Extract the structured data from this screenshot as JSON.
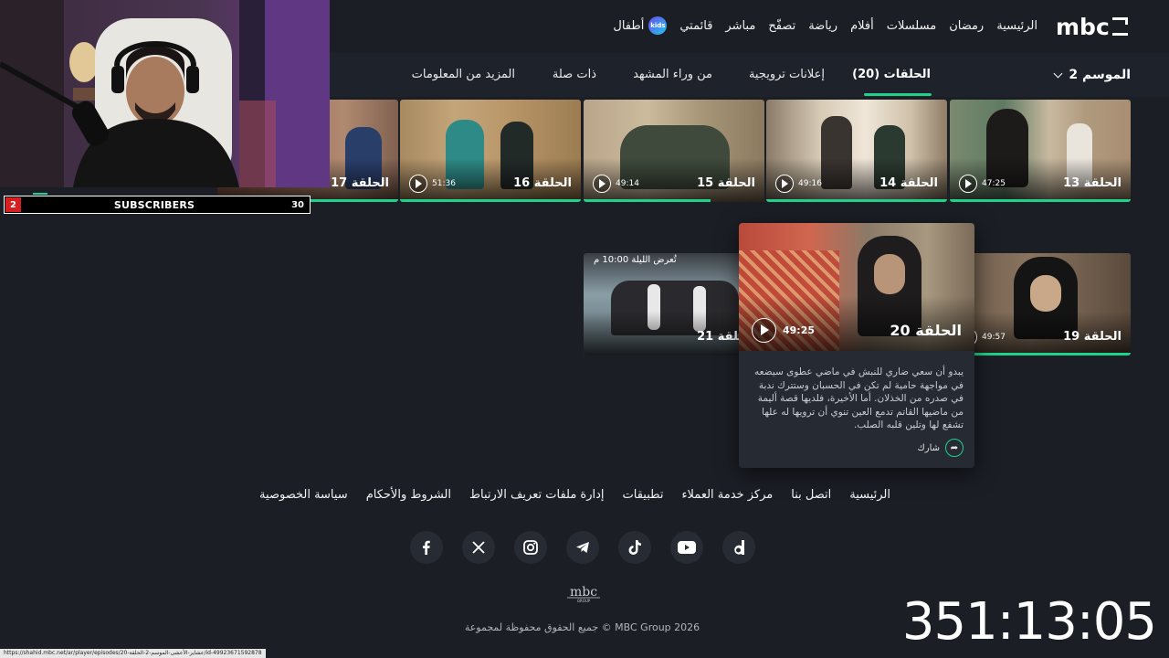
{
  "nav": {
    "logo": "mbc",
    "items": [
      "الرئيسية",
      "رمضان",
      "مسلسلات",
      "أفلام",
      "رياضة",
      "تصفّح",
      "مباشر",
      "قائمتي"
    ],
    "kids_label": "أطفال",
    "kids_badge": "kids"
  },
  "season": {
    "label": "الموسم 2"
  },
  "tabs": [
    "الحلقات (20)",
    "إعلانات ترويجية",
    "من وراء المشهد",
    "ذات صلة",
    "المزيد من المعلومات"
  ],
  "row1": [
    {
      "title": "الحلقة 13",
      "duration": "47:25"
    },
    {
      "title": "الحلقة 14",
      "duration": "49:16"
    },
    {
      "title": "الحلقة 15",
      "duration": "49:14"
    },
    {
      "title": "الحلقة 16",
      "duration": "51:36"
    },
    {
      "title": "الحلقة 17",
      "duration": ""
    }
  ],
  "row2": [
    {
      "title": "الحلقة 19",
      "duration": "49:57"
    },
    {
      "title": "الحلقة 21",
      "duration": ""
    }
  ],
  "tonight": "تُعرض الليلة 10:00 م",
  "hover": {
    "title": "الحلقة 20",
    "duration": "49:25",
    "description": "يبدو أن سعي ضاري للنبش في ماضي عطوى سيضعه في مواجهة حامية لم تكن في الحسبان وستترك ندبة في صدره من الخذلان. أما الأخيرة، فلديها قصة أليمة من ماضيها القاتم تدمع العين تنوي أن ترويها له علها تشفع لها وتلين قلبه الصلب.",
    "share": "شارك"
  },
  "footer": {
    "links": [
      "الرئيسية",
      "اتصل بنا",
      "مركز خدمة العملاء",
      "تطبيقات",
      "إدارة ملفات تعريف الارتباط",
      "الشروط والأحكام",
      "سياسة الخصوصية"
    ],
    "socials": [
      "facebook-icon",
      "x-icon",
      "instagram-icon",
      "telegram-icon",
      "tiktok-icon",
      "youtube-icon",
      "dailymotion-icon"
    ],
    "copyright": "جميع الحقوق محفوظة لمجموعة © MBC Group 2026",
    "logo": "mbc",
    "logo_sub": "GROUP"
  },
  "status_url": "https://shahid.mbc.net/ar/player/episodes/عشاير-الأعشى-الموسم-2-الحلقة-20/id-49923671592878",
  "overlay": {
    "sub_count": "2",
    "sub_label": "SUBSCRIBERS",
    "sub_goal": "30",
    "sub_progress": 0.07,
    "timer": "351:13:05"
  },
  "colors": {
    "accent": "#1fd18a",
    "background": "#1b1e25",
    "red": "#d81f1f"
  }
}
